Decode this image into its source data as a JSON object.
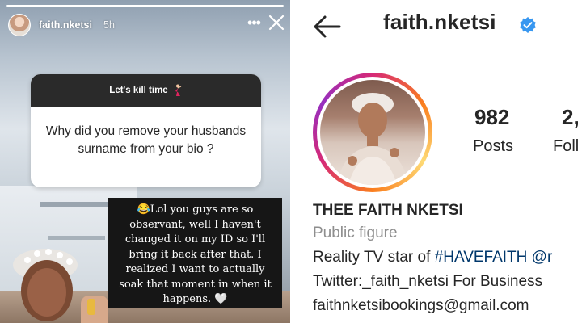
{
  "story": {
    "username": "faith.nketsi",
    "time_ago": "5h",
    "more_icon": "more-horizontal-icon",
    "close_icon": "close-icon",
    "progress": 1.0,
    "question_sticker": {
      "header": "Let's kill time",
      "header_icon": "dancer-icon",
      "question": "Why did you remove your husbands surname from your bio ?"
    },
    "answer": "😂Lol you guys are so observant, well I haven't changed it on my ID so I'll bring it back after that. I realized I want to actually soak that moment in when it happens. 🤍"
  },
  "profile": {
    "back_icon": "back-arrow-icon",
    "username": "faith.nketsi",
    "verified_icon": "verified-badge-icon",
    "verified_color": "#3897f0",
    "stats": {
      "posts_count": "982",
      "posts_label": "Posts",
      "followers_count": "2,",
      "followers_label": "Foll"
    },
    "bio": {
      "name": "THEE FAITH NKETSI",
      "category": "Public figure",
      "line1_prefix": "Reality TV star of ",
      "line1_hashtag": "#HAVEFAITH @r",
      "line2": "Twitter:_faith_nketsi For Business",
      "line3": "faithnketsibookings@gmail.com"
    },
    "ring_colors": [
      "#d62976",
      "#fa7e1e",
      "#feda75",
      "#962fbf"
    ],
    "link_color": "#00376b"
  }
}
